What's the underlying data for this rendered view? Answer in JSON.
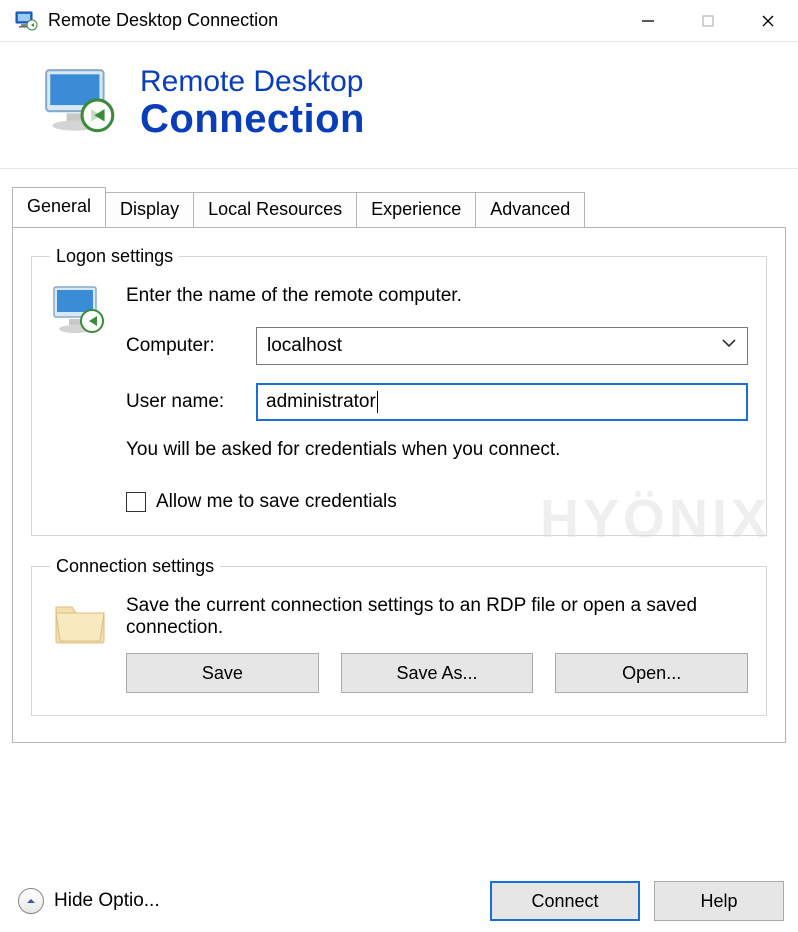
{
  "window": {
    "title": "Remote Desktop Connection"
  },
  "banner": {
    "line1": "Remote Desktop",
    "line2": "Connection"
  },
  "tabs": [
    {
      "label": "General",
      "active": true
    },
    {
      "label": "Display",
      "active": false
    },
    {
      "label": "Local Resources",
      "active": false
    },
    {
      "label": "Experience",
      "active": false
    },
    {
      "label": "Advanced",
      "active": false
    }
  ],
  "logon": {
    "legend": "Logon settings",
    "instruction": "Enter the name of the remote computer.",
    "computer_label": "Computer:",
    "computer_value": "localhost",
    "username_label": "User name:",
    "username_value": "administrator",
    "note": "You will be asked for credentials when you connect.",
    "save_creds_label": "Allow me to save credentials",
    "save_creds_checked": false
  },
  "connection": {
    "legend": "Connection settings",
    "instruction": "Save the current connection settings to an RDP file or open a saved connection.",
    "save_label": "Save",
    "saveas_label": "Save As...",
    "open_label": "Open..."
  },
  "footer": {
    "options_label": "Hide Optio...",
    "connect_label": "Connect",
    "help_label": "Help"
  },
  "watermark": "HYÖNIX"
}
